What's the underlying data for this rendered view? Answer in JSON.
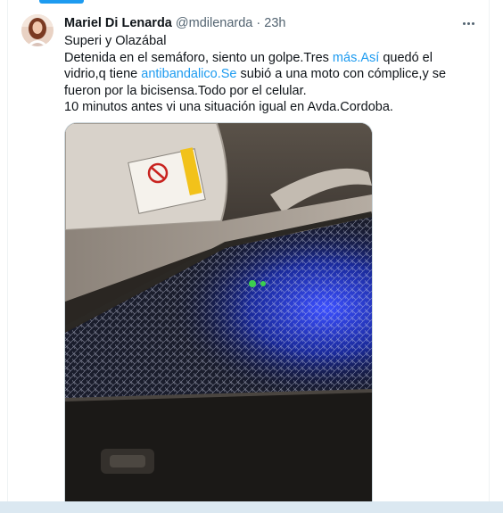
{
  "tweet": {
    "author_name": "Mariel Di Lenarda",
    "handle": "@mdilenarda",
    "separator": "·",
    "time": "23h",
    "line1": "Superi y Olazábal",
    "line2_a": "Detenida en el semáforo, siento un golpe.Tres ",
    "link_mas": "más.",
    "line2_b": " ",
    "link_asi": "Así",
    "line2_c": " quedó el vidrio,q tiene ",
    "link_antibandalico": "antibandalico.",
    "link_se": "Se",
    "line2_d": " subió a una moto con cómplice,y se fueron  por la bicisensa.Todo por el celular.",
    "line3": "10 minutos antes vi una situación igual en Avda.Cordoba."
  },
  "media": {
    "description_icon": "photo-shattered-car-window",
    "sticker_icon": "no-child-warning-sticker-icon"
  },
  "icons": {
    "more": "more-horizontal-icon",
    "avatar": "avatar"
  },
  "colors": {
    "link": "#1d9bf0",
    "secondary_text": "#536471",
    "primary_text": "#0f1419",
    "accent_bar": "#1d9bf0"
  }
}
